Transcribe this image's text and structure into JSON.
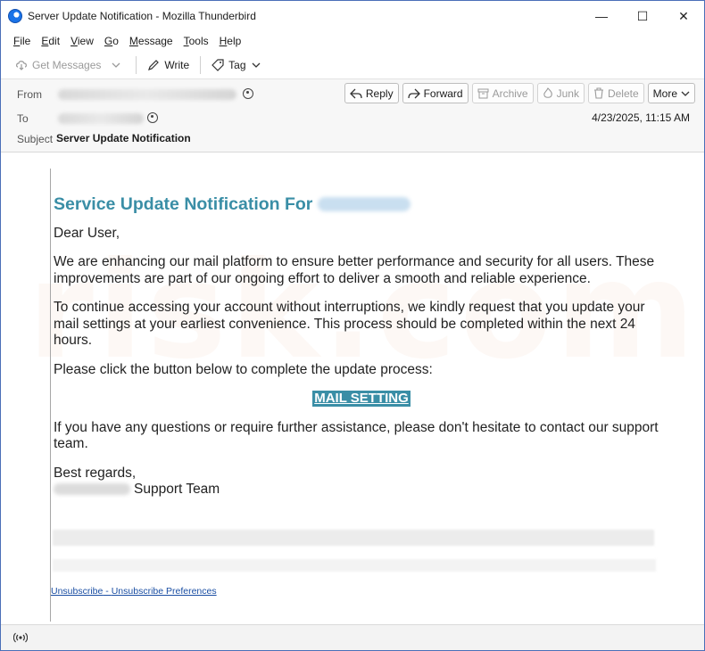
{
  "window": {
    "title": "Server Update Notification - Mozilla Thunderbird",
    "minimize_glyph": "—",
    "maximize_glyph": "☐",
    "close_glyph": "✕"
  },
  "menu": [
    {
      "first": "F",
      "rest": "ile"
    },
    {
      "first": "E",
      "rest": "dit"
    },
    {
      "first": "V",
      "rest": "iew"
    },
    {
      "first": "G",
      "rest": "o"
    },
    {
      "first": "M",
      "rest": "essage"
    },
    {
      "first": "T",
      "rest": "ools"
    },
    {
      "first": "H",
      "rest": "elp"
    }
  ],
  "toolbar": {
    "get_messages": "Get Messages",
    "write": "Write",
    "tag": "Tag"
  },
  "header": {
    "from_label": "From",
    "to_label": "To",
    "subject_label": "Subject",
    "subject": "Server Update Notification",
    "date": "4/23/2025, 11:15 AM",
    "actions": {
      "reply": "Reply",
      "forward": "Forward",
      "archive": "Archive",
      "junk": "Junk",
      "delete": "Delete",
      "more": "More"
    }
  },
  "message": {
    "heading": "Service Update Notification For",
    "greeting": "Dear User,",
    "para1": "We are enhancing our mail platform to ensure better performance and security for all users. These improvements are part of our ongoing effort to deliver a smooth and reliable experience.",
    "para2": "To continue accessing your account without interruptions, we kindly request that you update your mail settings at your earliest convenience. This process should be completed within the next 24 hours.",
    "para3": "Please click the button below to complete the update process:",
    "cta": "MAIL SETTING",
    "para4": "If you have any questions or require further assistance, please don't hesitate to contact our support team.",
    "closing": "Best regards,",
    "signature": "Support Team",
    "unsubscribe": "Unsubscribe",
    "separator": " - ",
    "unsubscribe_prefs": "Unsubscribe Preferences"
  },
  "watermark": "risk.com",
  "colors": {
    "accent": "#3a8ea6",
    "link": "#1a4ea3",
    "window_border": "#4a6fb8"
  }
}
